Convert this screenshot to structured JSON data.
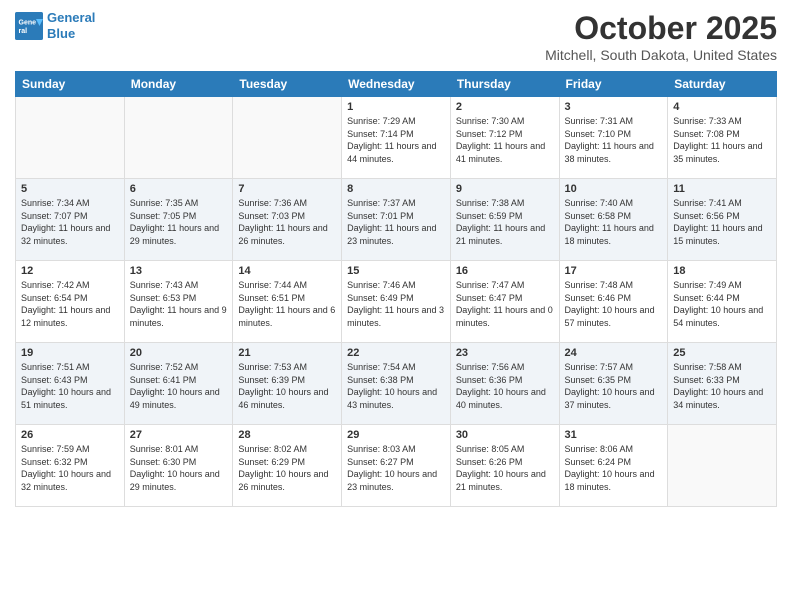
{
  "header": {
    "logo_line1": "General",
    "logo_line2": "Blue",
    "month": "October 2025",
    "location": "Mitchell, South Dakota, United States"
  },
  "weekdays": [
    "Sunday",
    "Monday",
    "Tuesday",
    "Wednesday",
    "Thursday",
    "Friday",
    "Saturday"
  ],
  "weeks": [
    [
      {
        "day": "",
        "text": ""
      },
      {
        "day": "",
        "text": ""
      },
      {
        "day": "",
        "text": ""
      },
      {
        "day": "1",
        "text": "Sunrise: 7:29 AM\nSunset: 7:14 PM\nDaylight: 11 hours and 44 minutes."
      },
      {
        "day": "2",
        "text": "Sunrise: 7:30 AM\nSunset: 7:12 PM\nDaylight: 11 hours and 41 minutes."
      },
      {
        "day": "3",
        "text": "Sunrise: 7:31 AM\nSunset: 7:10 PM\nDaylight: 11 hours and 38 minutes."
      },
      {
        "day": "4",
        "text": "Sunrise: 7:33 AM\nSunset: 7:08 PM\nDaylight: 11 hours and 35 minutes."
      }
    ],
    [
      {
        "day": "5",
        "text": "Sunrise: 7:34 AM\nSunset: 7:07 PM\nDaylight: 11 hours and 32 minutes."
      },
      {
        "day": "6",
        "text": "Sunrise: 7:35 AM\nSunset: 7:05 PM\nDaylight: 11 hours and 29 minutes."
      },
      {
        "day": "7",
        "text": "Sunrise: 7:36 AM\nSunset: 7:03 PM\nDaylight: 11 hours and 26 minutes."
      },
      {
        "day": "8",
        "text": "Sunrise: 7:37 AM\nSunset: 7:01 PM\nDaylight: 11 hours and 23 minutes."
      },
      {
        "day": "9",
        "text": "Sunrise: 7:38 AM\nSunset: 6:59 PM\nDaylight: 11 hours and 21 minutes."
      },
      {
        "day": "10",
        "text": "Sunrise: 7:40 AM\nSunset: 6:58 PM\nDaylight: 11 hours and 18 minutes."
      },
      {
        "day": "11",
        "text": "Sunrise: 7:41 AM\nSunset: 6:56 PM\nDaylight: 11 hours and 15 minutes."
      }
    ],
    [
      {
        "day": "12",
        "text": "Sunrise: 7:42 AM\nSunset: 6:54 PM\nDaylight: 11 hours and 12 minutes."
      },
      {
        "day": "13",
        "text": "Sunrise: 7:43 AM\nSunset: 6:53 PM\nDaylight: 11 hours and 9 minutes."
      },
      {
        "day": "14",
        "text": "Sunrise: 7:44 AM\nSunset: 6:51 PM\nDaylight: 11 hours and 6 minutes."
      },
      {
        "day": "15",
        "text": "Sunrise: 7:46 AM\nSunset: 6:49 PM\nDaylight: 11 hours and 3 minutes."
      },
      {
        "day": "16",
        "text": "Sunrise: 7:47 AM\nSunset: 6:47 PM\nDaylight: 11 hours and 0 minutes."
      },
      {
        "day": "17",
        "text": "Sunrise: 7:48 AM\nSunset: 6:46 PM\nDaylight: 10 hours and 57 minutes."
      },
      {
        "day": "18",
        "text": "Sunrise: 7:49 AM\nSunset: 6:44 PM\nDaylight: 10 hours and 54 minutes."
      }
    ],
    [
      {
        "day": "19",
        "text": "Sunrise: 7:51 AM\nSunset: 6:43 PM\nDaylight: 10 hours and 51 minutes."
      },
      {
        "day": "20",
        "text": "Sunrise: 7:52 AM\nSunset: 6:41 PM\nDaylight: 10 hours and 49 minutes."
      },
      {
        "day": "21",
        "text": "Sunrise: 7:53 AM\nSunset: 6:39 PM\nDaylight: 10 hours and 46 minutes."
      },
      {
        "day": "22",
        "text": "Sunrise: 7:54 AM\nSunset: 6:38 PM\nDaylight: 10 hours and 43 minutes."
      },
      {
        "day": "23",
        "text": "Sunrise: 7:56 AM\nSunset: 6:36 PM\nDaylight: 10 hours and 40 minutes."
      },
      {
        "day": "24",
        "text": "Sunrise: 7:57 AM\nSunset: 6:35 PM\nDaylight: 10 hours and 37 minutes."
      },
      {
        "day": "25",
        "text": "Sunrise: 7:58 AM\nSunset: 6:33 PM\nDaylight: 10 hours and 34 minutes."
      }
    ],
    [
      {
        "day": "26",
        "text": "Sunrise: 7:59 AM\nSunset: 6:32 PM\nDaylight: 10 hours and 32 minutes."
      },
      {
        "day": "27",
        "text": "Sunrise: 8:01 AM\nSunset: 6:30 PM\nDaylight: 10 hours and 29 minutes."
      },
      {
        "day": "28",
        "text": "Sunrise: 8:02 AM\nSunset: 6:29 PM\nDaylight: 10 hours and 26 minutes."
      },
      {
        "day": "29",
        "text": "Sunrise: 8:03 AM\nSunset: 6:27 PM\nDaylight: 10 hours and 23 minutes."
      },
      {
        "day": "30",
        "text": "Sunrise: 8:05 AM\nSunset: 6:26 PM\nDaylight: 10 hours and 21 minutes."
      },
      {
        "day": "31",
        "text": "Sunrise: 8:06 AM\nSunset: 6:24 PM\nDaylight: 10 hours and 18 minutes."
      },
      {
        "day": "",
        "text": ""
      }
    ]
  ]
}
